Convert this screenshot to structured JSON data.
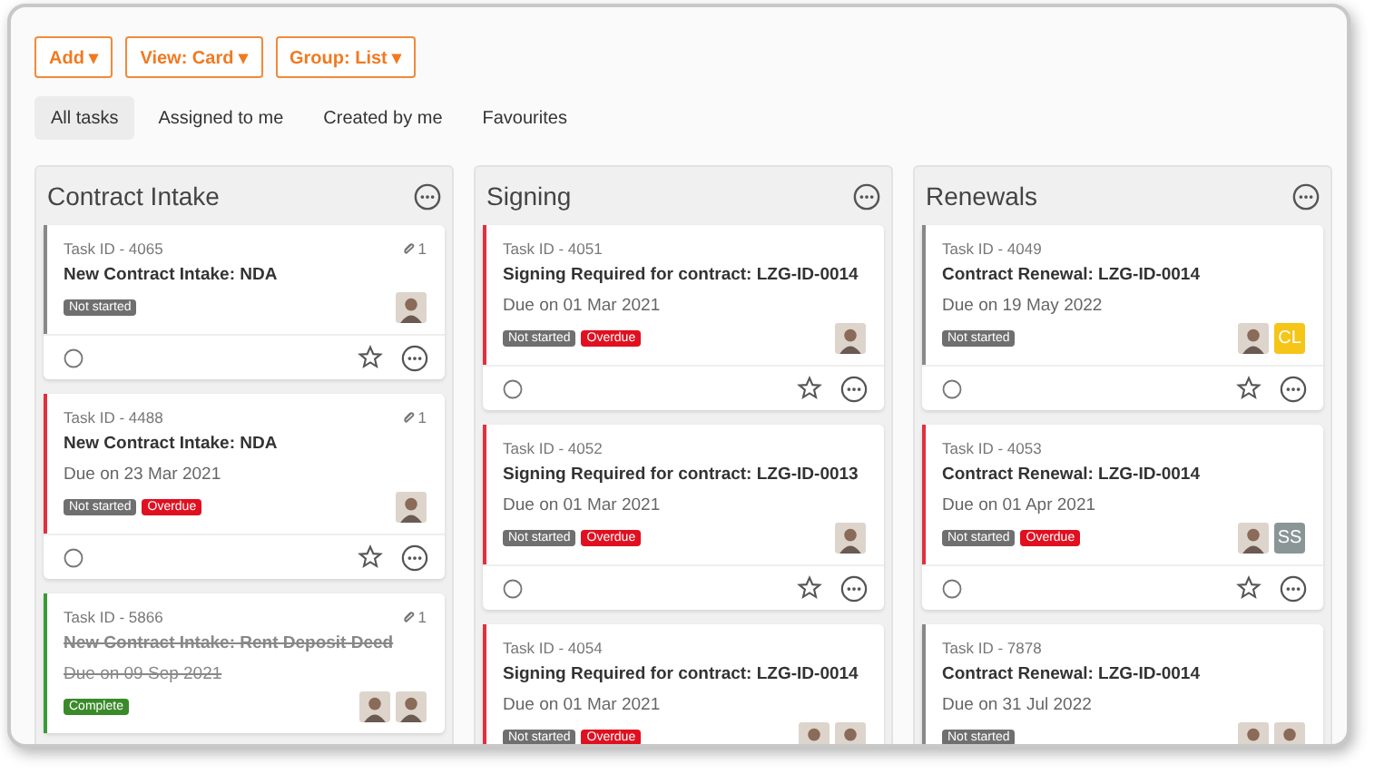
{
  "toolbar": {
    "buttons": [
      {
        "label": "Add",
        "caret": "▾"
      },
      {
        "label": "View: Card",
        "caret": "▾"
      },
      {
        "label": "Group: List",
        "caret": "▾"
      }
    ]
  },
  "tabs": [
    {
      "label": "All tasks",
      "selected": true
    },
    {
      "label": "Assigned to me",
      "selected": false
    },
    {
      "label": "Created by me",
      "selected": false
    },
    {
      "label": "Favourites",
      "selected": false
    }
  ],
  "columns": [
    {
      "title": "Contract Intake",
      "cards": [
        {
          "checked": false,
          "task_id": "Task ID - 4065",
          "attachments": "1",
          "title": "New Contract Intake: NDA",
          "status": {
            "label": "Not started",
            "kind": "not-started"
          },
          "avatars": [
            {
              "kind": "photo"
            }
          ]
        },
        {
          "checked": false,
          "task_id": "Task ID - 4488",
          "attachments": "1",
          "title": "New Contract Intake: NDA",
          "due": "Due on 23 Mar 2021",
          "status": {
            "label": "Not started",
            "kind": "not-started"
          },
          "overdue": "Overdue",
          "avatars": [
            {
              "kind": "photo"
            }
          ]
        },
        {
          "task_id": "Task ID - 5866",
          "attachments": "1",
          "title": "New Contract Intake: Rent Deposit Deed",
          "due": "Due on 09 Sep 2021",
          "status": {
            "label": "Complete",
            "kind": "complete"
          },
          "avatars": [
            {
              "kind": "photo"
            },
            {
              "kind": "photo"
            }
          ]
        }
      ]
    },
    {
      "title": "Signing",
      "cards": [
        {
          "checked": false,
          "task_id": "Task ID - 4051",
          "title": "Signing Required for contract: LZG-ID-0014",
          "due": "Due on 01 Mar 2021",
          "status": {
            "label": "Not started",
            "kind": "not-started"
          },
          "overdue": "Overdue",
          "avatars": [
            {
              "kind": "photo"
            }
          ]
        },
        {
          "checked": false,
          "task_id": "Task ID - 4052",
          "title": "Signing Required for contract: LZG-ID-0013",
          "due": "Due on 01 Mar 2021",
          "status": {
            "label": "Not started",
            "kind": "not-started"
          },
          "overdue": "Overdue",
          "avatars": [
            {
              "kind": "photo"
            }
          ]
        },
        {
          "task_id": "Task ID - 4054",
          "title": "Signing Required for contract: LZG-ID-0014",
          "due": "Due on 01 Mar 2021",
          "status": {
            "label": "Not started",
            "kind": "not-started"
          },
          "overdue": "Overdue",
          "avatars": [
            {
              "kind": "photo"
            },
            {
              "kind": "photo"
            }
          ]
        }
      ]
    },
    {
      "title": "Renewals",
      "cards": [
        {
          "checked": false,
          "task_id": "Task ID - 4049",
          "title": "Contract Renewal: LZG-ID-0014",
          "due": "Due on 19 May 2022",
          "status": {
            "label": "Not started",
            "kind": "not-started"
          },
          "avatars": [
            {
              "kind": "photo"
            },
            {
              "kind": "initials",
              "initials": "CL",
              "color": "#f5c518"
            }
          ]
        },
        {
          "checked": false,
          "task_id": "Task ID - 4053",
          "title": "Contract Renewal: LZG-ID-0014",
          "due": "Due on 01 Apr 2021",
          "status": {
            "label": "Not started",
            "kind": "not-started"
          },
          "overdue": "Overdue",
          "avatars": [
            {
              "kind": "photo"
            },
            {
              "kind": "initials",
              "initials": "SS",
              "color": "#8a9696"
            }
          ]
        },
        {
          "task_id": "Task ID - 7878",
          "title": "Contract Renewal: LZG-ID-0014",
          "due": "Due on 31 Jul 2022",
          "status": {
            "label": "Not started",
            "kind": "not-started"
          },
          "avatars": [
            {
              "kind": "photo"
            },
            {
              "kind": "photo"
            }
          ]
        }
      ]
    }
  ]
}
